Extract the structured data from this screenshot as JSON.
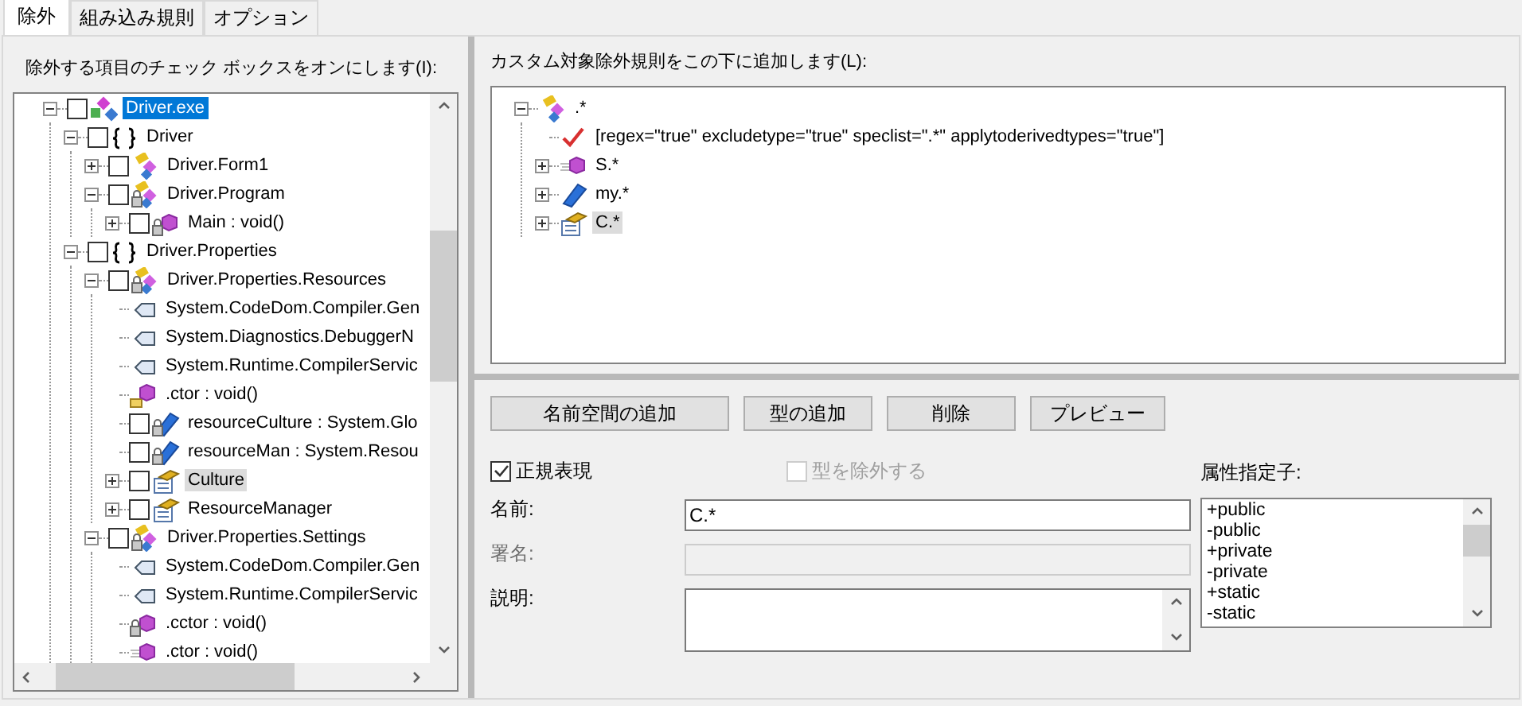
{
  "tabs": [
    {
      "label": "除外",
      "selected": true
    },
    {
      "label": "組み込み規則",
      "selected": false
    },
    {
      "label": "オプション",
      "selected": false
    }
  ],
  "exclude_tree": {
    "label": "除外する項目のチェック ボックスをオンにします(I):",
    "nodes": [
      {
        "label": "Driver.exe",
        "kind": "assembly",
        "checked": false,
        "selected": true,
        "expanded": true,
        "children": [
          {
            "label": "Driver",
            "kind": "namespace",
            "checked": false,
            "selected": false,
            "expanded": true,
            "children": [
              {
                "label": "Driver.Form1",
                "kind": "class",
                "checked": false,
                "selected": false,
                "expanded": false
              },
              {
                "label": "Driver.Program",
                "kind": "class_locked",
                "checked": false,
                "selected": false,
                "expanded": true,
                "children": [
                  {
                    "label": "Main : void()",
                    "kind": "method_locked",
                    "checked": false,
                    "selected": false,
                    "expanded": false
                  }
                ]
              }
            ]
          },
          {
            "label": "Driver.Properties",
            "kind": "namespace",
            "checked": false,
            "selected": false,
            "expanded": true,
            "children": [
              {
                "label": "Driver.Properties.Resources",
                "kind": "class_locked",
                "checked": false,
                "selected": false,
                "expanded": true,
                "children": [
                  {
                    "label": "System.CodeDom.Compiler.Gen",
                    "kind": "attribute",
                    "selected": false
                  },
                  {
                    "label": "System.Diagnostics.DebuggerN",
                    "kind": "attribute",
                    "selected": false
                  },
                  {
                    "label": "System.Runtime.CompilerServic",
                    "kind": "attribute",
                    "selected": false
                  },
                  {
                    "label": ".ctor : void()",
                    "kind": "method_internal",
                    "selected": false
                  },
                  {
                    "label": "resourceCulture : System.Glo",
                    "kind": "field_locked",
                    "checked": false,
                    "selected": false
                  },
                  {
                    "label": "resourceMan : System.Resou",
                    "kind": "field_locked",
                    "checked": false,
                    "selected": false
                  },
                  {
                    "label": "Culture",
                    "kind": "property",
                    "checked": false,
                    "selected": false,
                    "hovered": true,
                    "expanded": false
                  },
                  {
                    "label": "ResourceManager",
                    "kind": "property",
                    "checked": false,
                    "selected": false,
                    "expanded": false
                  }
                ]
              },
              {
                "label": "Driver.Properties.Settings",
                "kind": "class_locked",
                "checked": false,
                "selected": false,
                "expanded": true,
                "children": [
                  {
                    "label": "System.CodeDom.Compiler.Gen",
                    "kind": "attribute",
                    "selected": false
                  },
                  {
                    "label": "System.Runtime.CompilerServic",
                    "kind": "attribute",
                    "selected": false
                  },
                  {
                    "label": ".cctor : void()",
                    "kind": "method_locked",
                    "selected": false
                  },
                  {
                    "label": ".ctor : void()",
                    "kind": "method_plain",
                    "selected": false
                  }
                ]
              }
            ]
          }
        ]
      }
    ]
  },
  "rules_tree": {
    "label": "カスタム対象除外規則をこの下に追加します(L):",
    "nodes": [
      {
        "label": ".*",
        "kind": "class",
        "selected": false,
        "expanded": true,
        "children": [
          {
            "label": "[regex=\"true\" excludetype=\"true\" speclist=\".*\" applytoderivedtypes=\"true\"]",
            "kind": "rule",
            "selected": false
          },
          {
            "label": "S.*",
            "kind": "method_plain",
            "selected": false,
            "expanded": false
          },
          {
            "label": "my.*",
            "kind": "field",
            "selected": false,
            "expanded": false
          },
          {
            "label": "C.*",
            "kind": "property",
            "selected": false,
            "hovered": true,
            "expanded": false
          }
        ]
      }
    ]
  },
  "buttons": [
    "名前空間の追加",
    "型の追加",
    "削除",
    "プレビュー"
  ],
  "options": [
    {
      "label": "正規表現",
      "checked": true,
      "disabled": false
    },
    {
      "label": "型を除外する",
      "checked": false,
      "disabled": true
    }
  ],
  "fields": [
    {
      "label": "名前:",
      "value": "C.*",
      "kind": "input",
      "disabled": false
    },
    {
      "label": "署名:",
      "kind": "input",
      "disabled": true
    },
    {
      "label": "説明:",
      "kind": "textarea",
      "disabled": false
    }
  ],
  "attribute_specifiers": {
    "label": "属性指定子:",
    "items": [
      "+public",
      "-public",
      "+private",
      "-private",
      "+static",
      "-static"
    ]
  }
}
